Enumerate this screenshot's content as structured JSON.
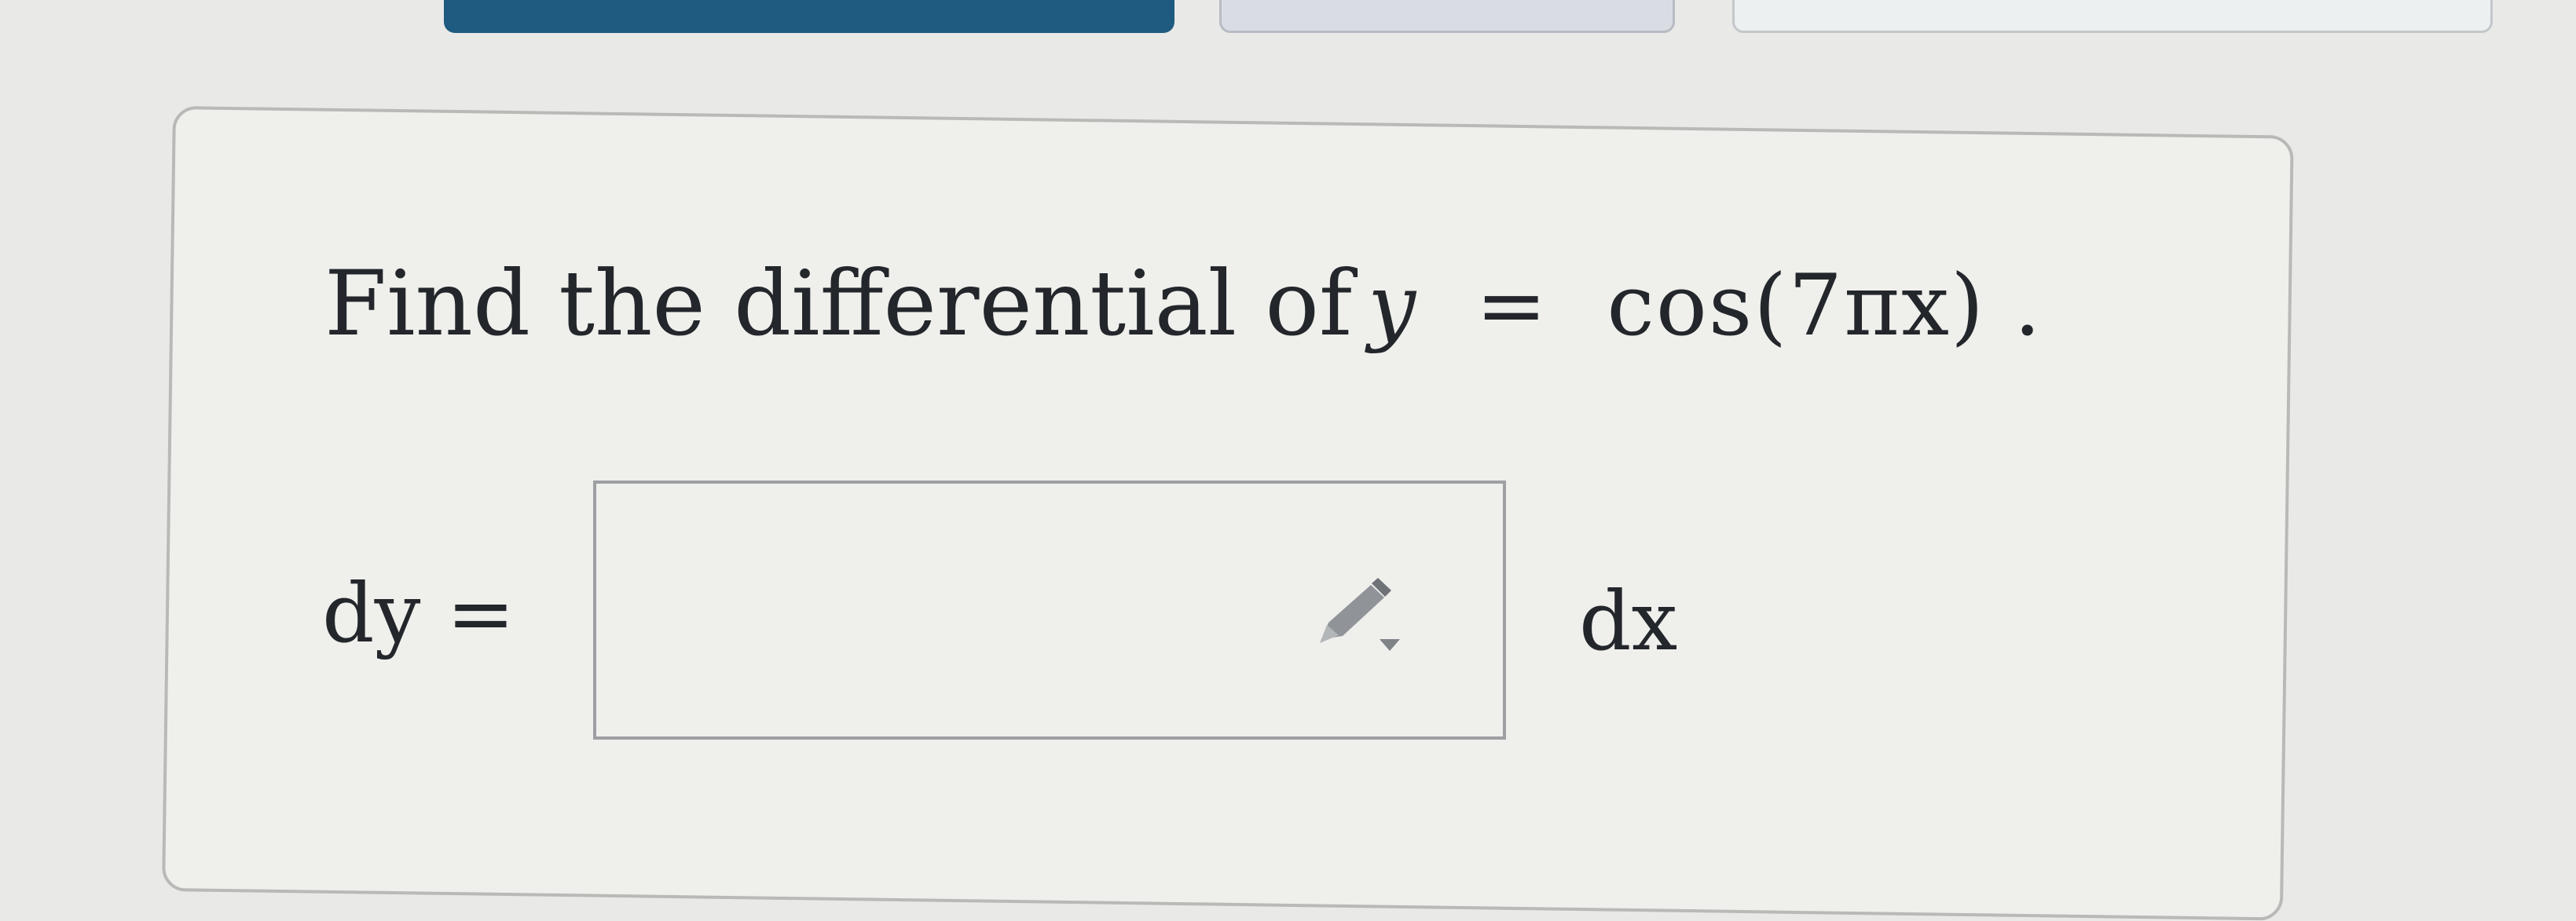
{
  "top_tabs": {
    "primary": "",
    "secondary": "",
    "tertiary": ""
  },
  "question": {
    "text": "Find the differential of",
    "math": {
      "variable": "y",
      "operator": "=",
      "expression": "cos(7πx)",
      "period": "."
    }
  },
  "answer": {
    "left_label": "dy =",
    "input_value": "",
    "input_placeholder": "",
    "right_label": "dx"
  },
  "icons": {
    "input_tool": "pencil-icon"
  },
  "colors": {
    "primary_tab": "#1f5b80",
    "text": "#23272b",
    "input_border": "#9d9fa2"
  }
}
